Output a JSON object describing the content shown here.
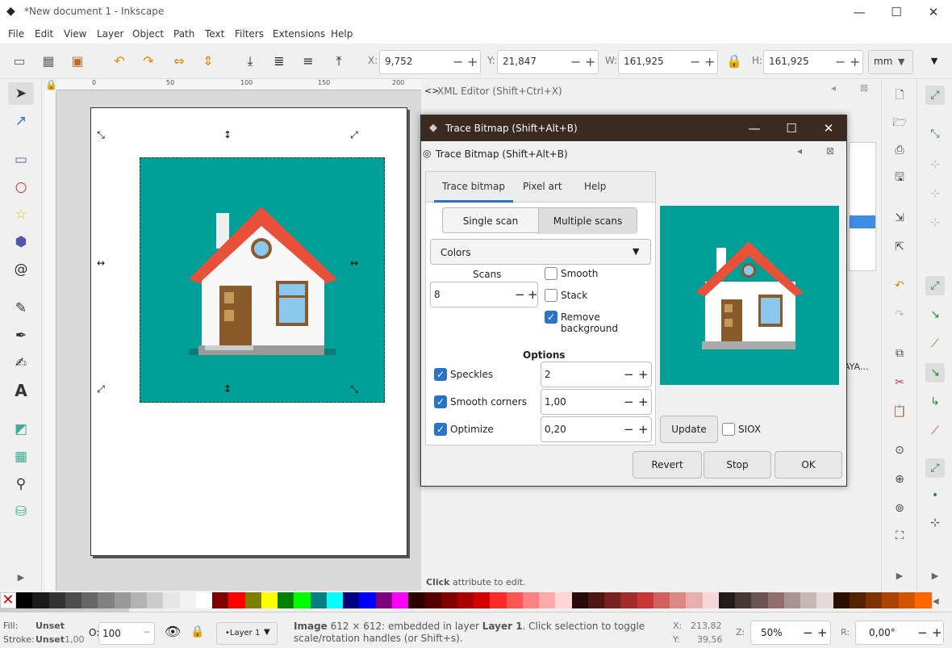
{
  "window": {
    "title": "*New document 1 - Inkscape",
    "min": "—",
    "max": "☐",
    "close": "✕"
  },
  "menu": [
    "File",
    "Edit",
    "View",
    "Layer",
    "Object",
    "Path",
    "Text",
    "Filters",
    "Extensions",
    "Help"
  ],
  "toolbar": {
    "x_label": "X:",
    "x_value": "9,752",
    "y_label": "Y:",
    "y_value": "21,847",
    "w_label": "W:",
    "w_value": "161,925",
    "h_label": "H:",
    "h_value": "161,925",
    "unit": "mm"
  },
  "ruler_top_labels": [
    "0",
    "50",
    "100",
    "150",
    "200"
  ],
  "xml_editor": {
    "title": "XML Editor (Shift+Ctrl+X)",
    "hint_bold": "Click",
    "hint_rest": " attribute to edit.",
    "truncated": "AYA..."
  },
  "dialog": {
    "title": "Trace Bitmap (Shift+Alt+B)",
    "subtitle": "Trace Bitmap (Shift+Alt+B)",
    "tabs": [
      "Trace bitmap",
      "Pixel art",
      "Help"
    ],
    "scan_modes": [
      "Single scan",
      "Multiple scans"
    ],
    "mode": "Colors",
    "scans_label": "Scans",
    "scans_value": "8",
    "smooth": "Smooth",
    "stack": "Stack",
    "remove_background": "Remove background",
    "options_label": "Options",
    "speckles_label": "Speckles",
    "speckles_value": "2",
    "smooth_corners_label": "Smooth corners",
    "smooth_corners_value": "1,00",
    "optimize_label": "Optimize",
    "optimize_value": "0,20",
    "update": "Update",
    "siox": "SIOX",
    "revert": "Revert",
    "stop": "Stop",
    "ok": "OK"
  },
  "status": {
    "fill_label": "Fill:",
    "fill_value": "Unset",
    "stroke_label": "Stroke:",
    "stroke_value": "Unset",
    "stroke_width": "1,00",
    "opacity_label": "O:",
    "opacity_value": "100",
    "layer": "•Layer 1",
    "message_bold1": "Image",
    "message1": " 612 × 612: embedded in layer ",
    "message_bold2": "Layer 1",
    "message2": ". Click selection to toggle scale/rotation handles (or Shift+s).",
    "cx_label": "X:",
    "cx_value": "213,82",
    "cy_label": "Y:",
    "cy_value": "39,56",
    "zoom_label": "Z:",
    "zoom_value": "50%",
    "rot_label": "R:",
    "rot_value": "0,00°"
  },
  "palette": [
    "#000000",
    "#1a1a1a",
    "#333333",
    "#4d4d4d",
    "#666666",
    "#808080",
    "#999999",
    "#b3b3b3",
    "#cccccc",
    "#e6e6e6",
    "#f2f2f2",
    "#ffffff",
    "#800000",
    "#ff0000",
    "#808000",
    "#ffff00",
    "#008000",
    "#00ff00",
    "#008080",
    "#00ffff",
    "#000080",
    "#0000ff",
    "#800080",
    "#ff00ff",
    "#2b0000",
    "#550000",
    "#800000",
    "#aa0000",
    "#d40000",
    "#ff2a2a",
    "#ff5555",
    "#ff8080",
    "#ffaaaa",
    "#ffd5d5",
    "#280b0b",
    "#501616",
    "#782121",
    "#a02c2c",
    "#c83737",
    "#d35f5f",
    "#de8787",
    "#e9afaf",
    "#f4d7d7",
    "#241c1c",
    "#483737",
    "#6c5353",
    "#916f6f",
    "#ac9393",
    "#c8b7b7",
    "#e3dbdb",
    "#2b1100",
    "#552200",
    "#803300",
    "#aa4400",
    "#d45500",
    "#ff6600"
  ]
}
